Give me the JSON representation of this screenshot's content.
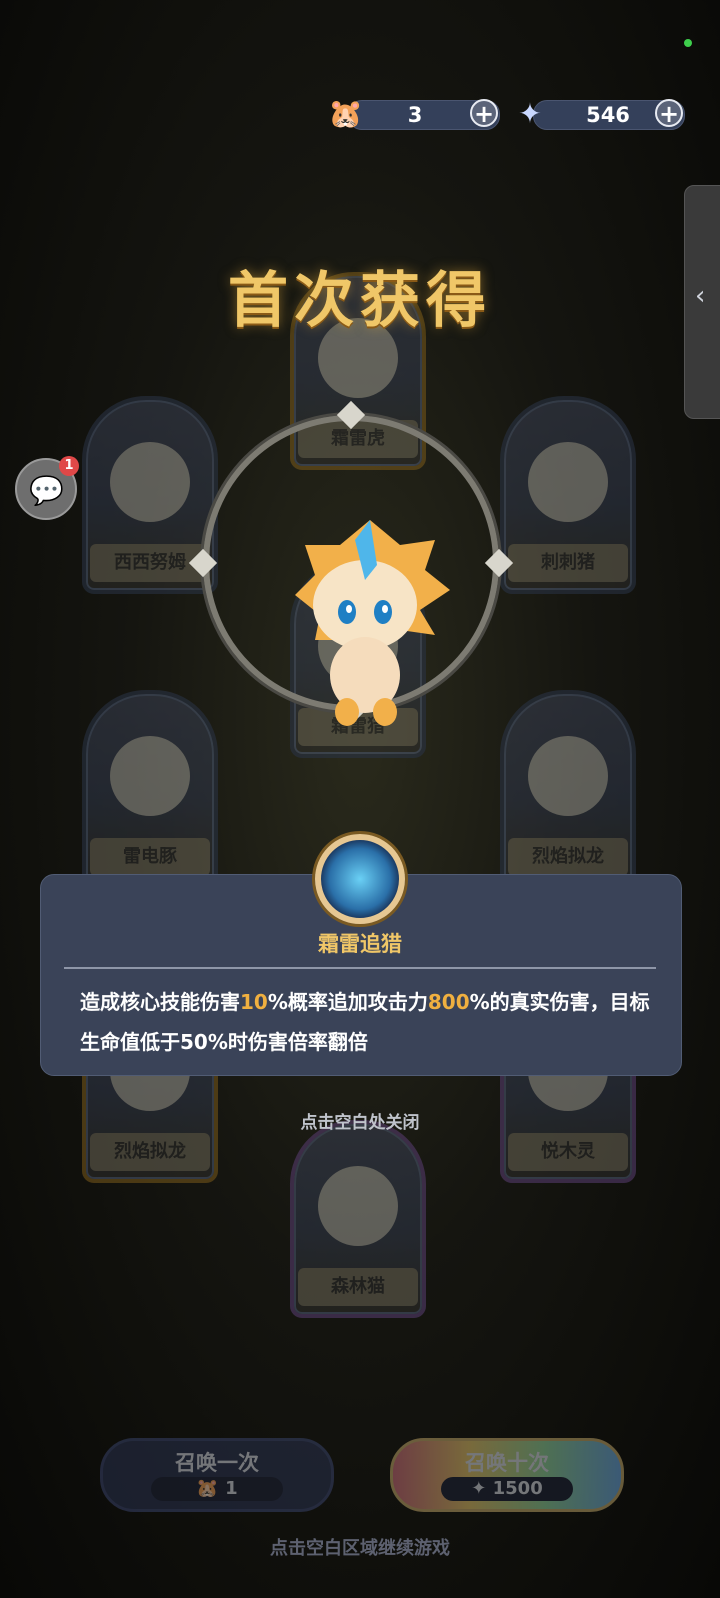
{
  "currency": {
    "tickets": {
      "icon": "hamster-ticket-icon",
      "value": "3"
    },
    "stars": {
      "icon": "star-crystal-icon",
      "value": "546"
    }
  },
  "title": "首次获得",
  "cards": {
    "top": "霜雷虎",
    "left_upper": "西西努姆",
    "right_upper": "刺刺猪",
    "center": "霜雷猎",
    "left_middle": "雷电豚",
    "right_middle": "烈焰拟龙",
    "left_lower": "烈焰拟龙",
    "right_lower": "悦木灵",
    "bottom": "森林猫"
  },
  "chat": {
    "badge": "1"
  },
  "skill": {
    "name": "霜雷追猎",
    "desc_a": "造成核心技能伤害",
    "desc_hl1": "10",
    "desc_b": "%概率追加攻击力",
    "desc_hl2": "800",
    "desc_c": "%的真实伤害，目标生命值低于50%时伤害倍率翻倍"
  },
  "hint_close": "点击空白处关闭",
  "summon": {
    "one": {
      "label": "召唤一次",
      "cost": "1"
    },
    "ten": {
      "label": "召唤十次",
      "cost": "1500"
    }
  },
  "hint_continue": "点击空白区域继续游戏",
  "colors": {
    "accent_gold": "#f0c768",
    "highlight": "#f0b040",
    "panel": "#3a4358"
  }
}
